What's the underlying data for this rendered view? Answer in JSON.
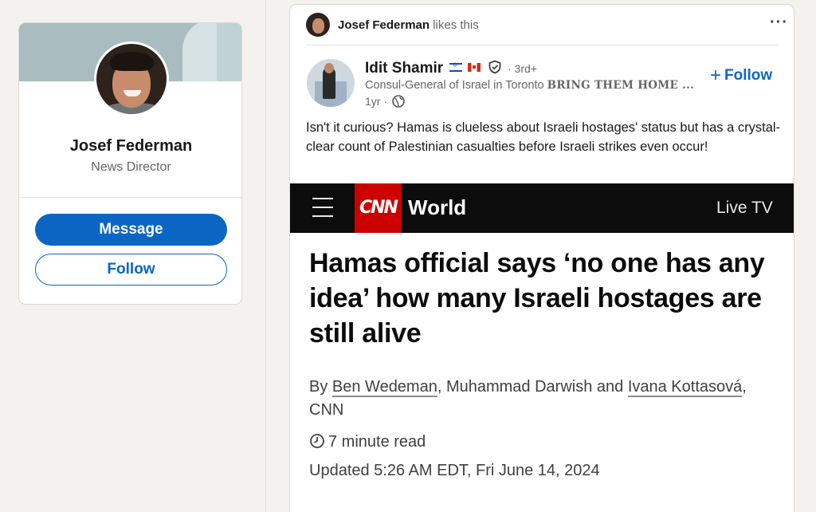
{
  "profile": {
    "name": "Josef Federman",
    "headline": "News Director",
    "message_label": "Message",
    "follow_label": "Follow"
  },
  "post": {
    "social": {
      "actor": "Josef Federman",
      "action": "likes this",
      "more_label": "···"
    },
    "author": {
      "name": "Idit Shamir",
      "degree": "· 3rd+",
      "headline_prefix": "Consul-General of Israel in Toronto ",
      "headline_emphasis": "BRING THEM HOME ...",
      "time": "1yr ·",
      "follow_label": "Follow",
      "flags": [
        "israel-flag-icon",
        "canada-flag-icon"
      ]
    },
    "text": "Isn't it curious? Hamas is clueless about Israeli hostages' status but has a crystal-clear count of Palestinian casualties before Israeli strikes even occur!"
  },
  "article": {
    "logo": "CNN",
    "section": "World",
    "live": "Live TV",
    "headline": "Hamas official says ‘no one has any idea’ how many Israeli hostages are still alive",
    "byline": {
      "by": "By ",
      "author1": "Ben Wedeman",
      "sep1": ", Muhammad Darwish and ",
      "author2": "Ivana Kottasová",
      "tail": ", CNN"
    },
    "read_time": "7 minute read",
    "updated": "Updated 5:26 AM EDT, Fri June 14, 2024"
  },
  "colors": {
    "accent": "#0a66c2",
    "cnn_red": "#cc0000",
    "background": "#f4f2ee"
  }
}
